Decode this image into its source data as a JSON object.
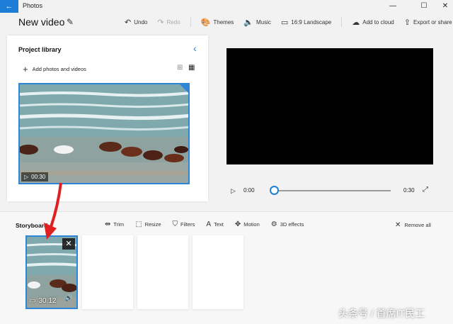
{
  "window": {
    "app_name": "Photos",
    "back_icon": "back-arrow-icon",
    "minimize": "—",
    "maximize": "☐",
    "close": "✕"
  },
  "header": {
    "project_title": "New video",
    "edit_icon": "✎",
    "toolbar": [
      {
        "label": "Undo",
        "icon": "↶",
        "enabled": true
      },
      {
        "label": "Redo",
        "icon": "↷",
        "enabled": false
      },
      {
        "label": "Themes",
        "icon": "🎨",
        "enabled": true
      },
      {
        "label": "Music",
        "icon": "🔈",
        "enabled": true
      },
      {
        "label": "16:9 Landscape",
        "icon": "▭",
        "enabled": true
      },
      {
        "label": "Add to cloud",
        "icon": "☁",
        "enabled": true
      },
      {
        "label": "Export or share",
        "icon": "⇪",
        "enabled": true
      },
      {
        "label": "···",
        "icon": "",
        "enabled": true
      }
    ]
  },
  "library": {
    "title": "Project library",
    "add_label": "Add photos and videos",
    "collapse_icon": "‹",
    "item": {
      "duration": "00:30",
      "play_icon": "▷"
    }
  },
  "player": {
    "play_icon": "▷",
    "current_time": "0:00",
    "end_time": "0:30",
    "progress": 0,
    "fullscreen_icon": "⤢"
  },
  "storyboard": {
    "title": "Storyboard",
    "tools": [
      {
        "label": "Trim",
        "icon": "⇹"
      },
      {
        "label": "Resize",
        "icon": "⬚"
      },
      {
        "label": "Filters",
        "icon": "⛉"
      },
      {
        "label": "Text",
        "icon": "A"
      },
      {
        "label": "Motion",
        "icon": "✥"
      },
      {
        "label": "3D effects",
        "icon": "⚙"
      }
    ],
    "remove_all": "Remove all",
    "clip": {
      "duration": "30.12",
      "close": "✕",
      "audio": "🔊"
    }
  },
  "watermark": "头条号 / 首席IT民工",
  "colors": {
    "accent": "#1c7ed6",
    "arrow": "#e02020"
  }
}
